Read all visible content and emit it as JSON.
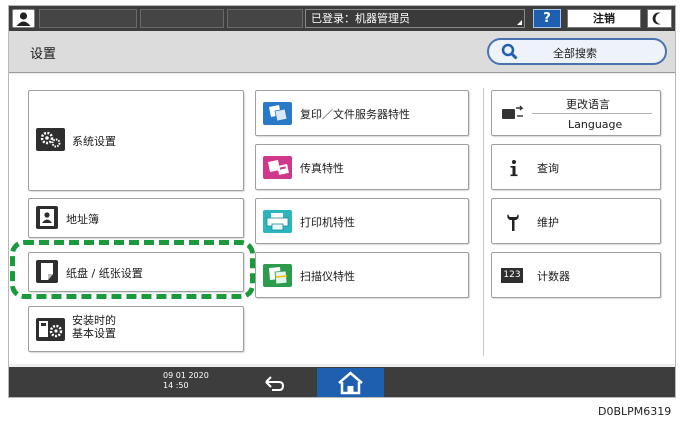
{
  "status_bar": {
    "login_text": "已登录：机器管理员",
    "help_label": "?",
    "logout_label": "注销"
  },
  "header": {
    "title": "设置",
    "search_label": "全部搜索"
  },
  "left_column": [
    {
      "label": "系统设置"
    },
    {
      "label": "地址簿"
    },
    {
      "label": "纸盘 / 纸张设置"
    },
    {
      "label_line1": "安装时的",
      "label_line2": "基本设置"
    }
  ],
  "middle_column": [
    {
      "label": "复印／文件服务器特性"
    },
    {
      "label": "传真特性"
    },
    {
      "label": "打印机特性"
    },
    {
      "label": "扫描仪特性"
    }
  ],
  "right_column": {
    "language": {
      "top": "更改语言",
      "bottom": "Language"
    },
    "inquiry": "查询",
    "maintenance": "维护",
    "counter": "计数器",
    "counter_icon_text": "123"
  },
  "bottom_bar": {
    "date": "09 01 2020",
    "time": "14 :50"
  },
  "caption": "D0BLPM6319",
  "colors": {
    "highlight": "#1a9a3c",
    "accent_blue": "#1f5fb0"
  }
}
